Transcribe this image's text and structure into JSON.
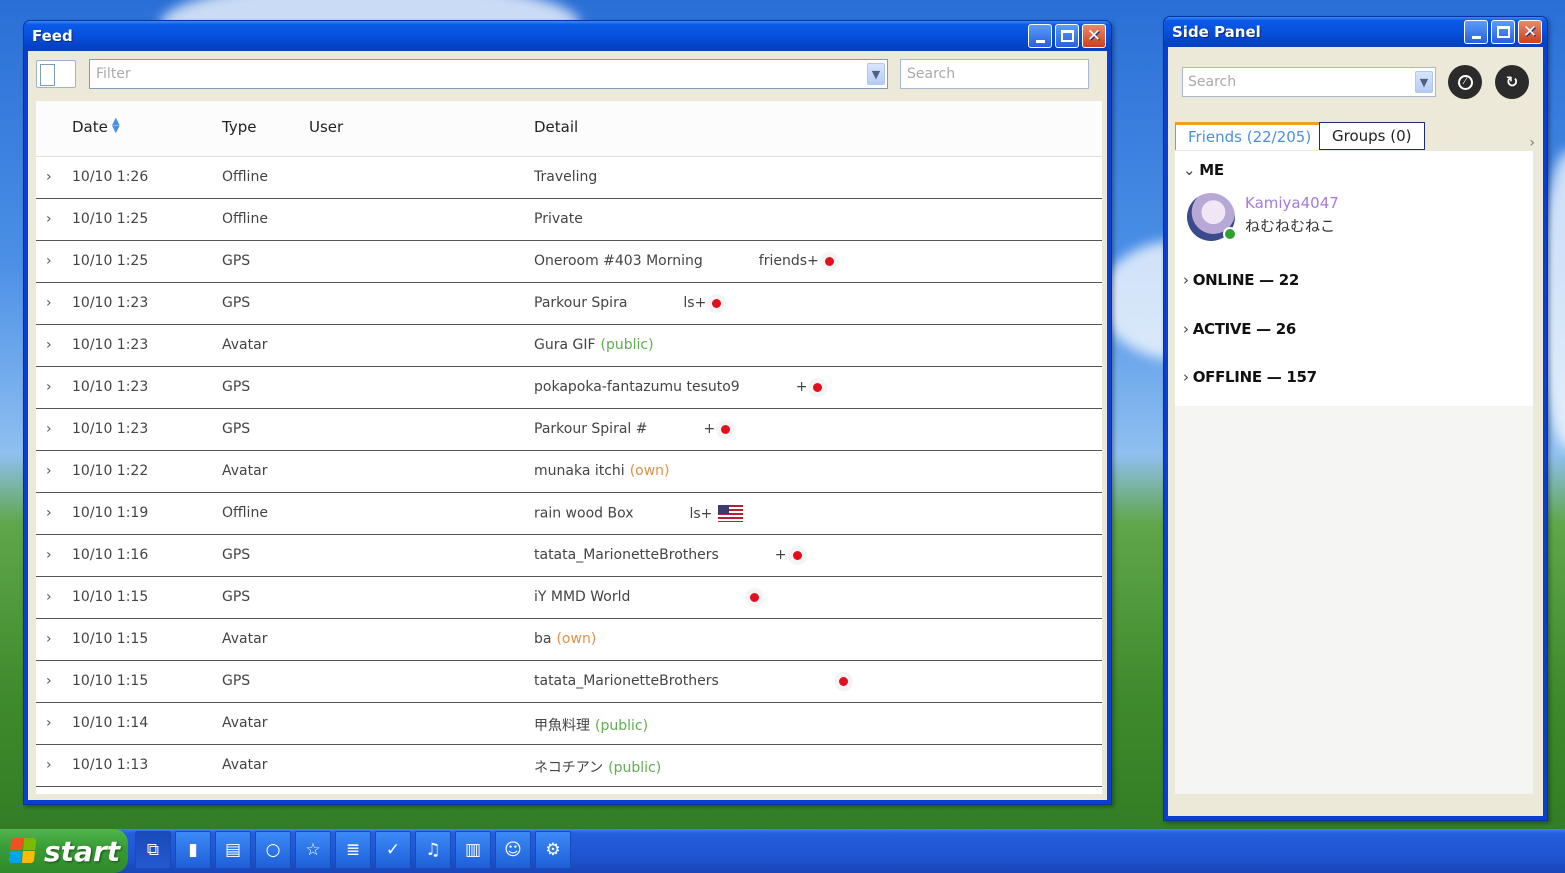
{
  "feed_window": {
    "title": "Feed",
    "filter_placeholder": "Filter",
    "search_placeholder": "Search",
    "columns": [
      "Date",
      "Type",
      "User",
      "Detail"
    ],
    "rows": [
      {
        "date": "10/10 1:26",
        "type": "Offline",
        "detail": "Traveling",
        "tag": "",
        "tag_color": "",
        "extra": "",
        "marker": ""
      },
      {
        "date": "10/10 1:25",
        "type": "Offline",
        "detail": "Private",
        "tag": "",
        "tag_color": "",
        "extra": "",
        "marker": ""
      },
      {
        "date": "10/10 1:25",
        "type": "GPS",
        "detail": "Oneroom #403 Morning",
        "tag": "",
        "tag_color": "",
        "extra": "friends+",
        "marker": "dot"
      },
      {
        "date": "10/10 1:23",
        "type": "GPS",
        "detail": "Parkour Spira",
        "tag": "",
        "tag_color": "",
        "extra": "ls+",
        "marker": "dot"
      },
      {
        "date": "10/10 1:23",
        "type": "Avatar",
        "detail": "Gura GIF",
        "tag": "(public)",
        "tag_color": "green",
        "extra": "",
        "marker": ""
      },
      {
        "date": "10/10 1:23",
        "type": "GPS",
        "detail": "pokapoka-fantazumu tesuto9",
        "tag": "",
        "tag_color": "",
        "extra": "+",
        "marker": "dot"
      },
      {
        "date": "10/10 1:23",
        "type": "GPS",
        "detail": "Parkour Spiral #",
        "tag": "",
        "tag_color": "",
        "extra": "+",
        "marker": "dot"
      },
      {
        "date": "10/10 1:22",
        "type": "Avatar",
        "detail": "munaka itchi",
        "tag": "(own)",
        "tag_color": "orange",
        "extra": "",
        "marker": ""
      },
      {
        "date": "10/10 1:19",
        "type": "Offline",
        "detail": "rain wood Box",
        "tag": "",
        "tag_color": "",
        "extra": "ls+",
        "marker": "flag"
      },
      {
        "date": "10/10 1:16",
        "type": "GPS",
        "detail": "tatata_MarionetteBrothers",
        "tag": "",
        "tag_color": "",
        "extra": "+",
        "marker": "dot"
      },
      {
        "date": "10/10 1:15",
        "type": "GPS",
        "detail": "iY MMD World",
        "tag": "",
        "tag_color": "",
        "extra": "",
        "marker": "dot"
      },
      {
        "date": "10/10 1:15",
        "type": "Avatar",
        "detail": "ba",
        "tag": "(own)",
        "tag_color": "orange",
        "extra": "",
        "marker": ""
      },
      {
        "date": "10/10 1:15",
        "type": "GPS",
        "detail": "tatata_MarionetteBrothers",
        "tag": "",
        "tag_color": "",
        "extra": "",
        "marker": "dot"
      },
      {
        "date": "10/10 1:14",
        "type": "Avatar",
        "detail": "甲魚料理",
        "tag": "(public)",
        "tag_color": "green",
        "extra": "",
        "marker": ""
      },
      {
        "date": "10/10 1:13",
        "type": "Avatar",
        "detail": "ネコチアン",
        "tag": "(public)",
        "tag_color": "green",
        "extra": "",
        "marker": ""
      }
    ]
  },
  "side_panel": {
    "title": "Side Panel",
    "search_placeholder": "Search",
    "tabs": [
      "Friends (22/205)",
      "Groups (0)"
    ],
    "groups": {
      "me": "ME",
      "online": "ONLINE — 22",
      "active": "ACTIVE — 26",
      "offline": "OFFLINE — 157"
    },
    "me": {
      "username": "Kamiya4047",
      "status": "ねむねむねこ",
      "status_color": "#2fa02f"
    }
  },
  "taskbar": {
    "start_label": "start",
    "icons": [
      "feed-icon",
      "charts-icon",
      "notes-icon",
      "search-icon",
      "favorites-icon",
      "log-icon",
      "moderation-icon",
      "notifications-icon",
      "library-icon",
      "profile-icon",
      "settings-icon"
    ]
  },
  "colors": {
    "accent": "#4a90e2",
    "public_tag": "#5fae4e",
    "own_tag": "#e0904a",
    "username": "#a47be0"
  }
}
